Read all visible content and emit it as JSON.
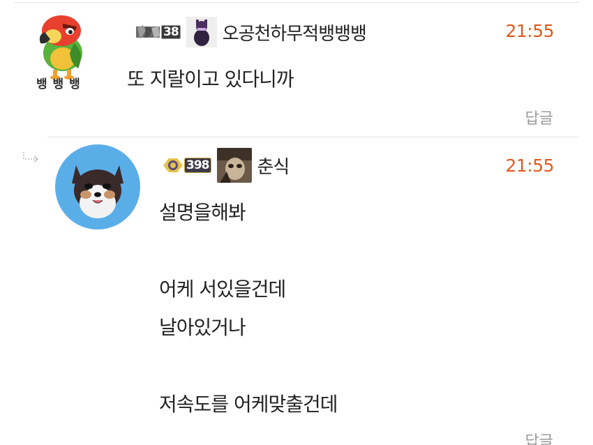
{
  "comments": [
    {
      "level": "38",
      "nickname": "오공천하무적뱅뱅뱅",
      "time": "21:55",
      "body": "또 지랄이고 있다니까",
      "reply_label": "답글",
      "avatar_caption": "뱅 뱅 뱅",
      "avatar_icon": "parrot-icon",
      "thumb_icon": "purple-character-icon"
    },
    {
      "level": "398",
      "nickname": "춘식",
      "time": "21:55",
      "body": "설명을해봐\n\n어케 서있을건데\n날아있거나\n\n저속도를 어케맞출건데",
      "reply_label": "답글",
      "avatar_icon": "dog-icon",
      "thumb_icon": "cat-photo-icon",
      "reply_indicator_icon": "reply-arrow-icon"
    }
  ],
  "colors": {
    "time": "#e05a1d",
    "reply_link": "#9a9a9a",
    "divider": "#e2e2e2",
    "dog_avatar_bg": "#5aaee8",
    "parrot_green": "#58b23c"
  }
}
